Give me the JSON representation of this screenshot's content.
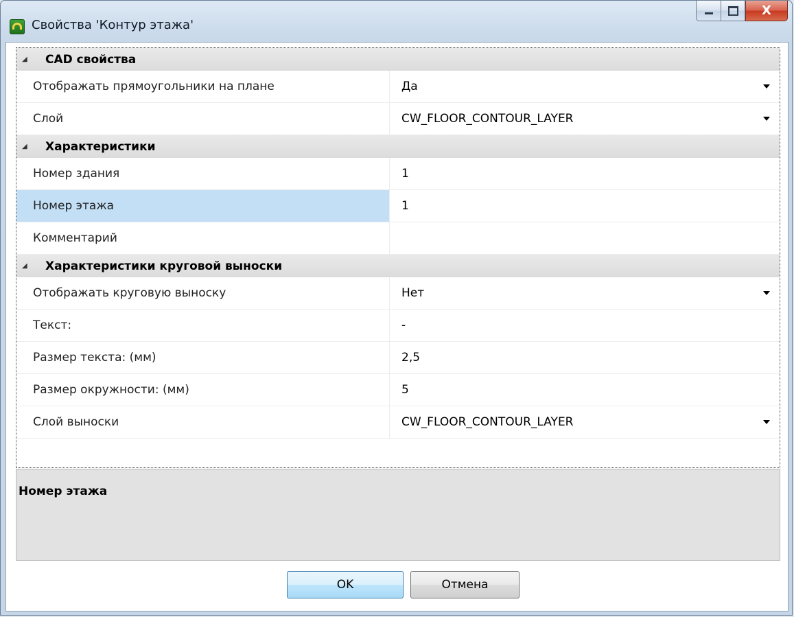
{
  "window": {
    "title": "Свойства 'Контур этажа'",
    "controls": {
      "minimize": "minimize",
      "maximize": "maximize",
      "close": "X"
    }
  },
  "grid": {
    "categories": [
      {
        "label": "CAD свойства",
        "rows": [
          {
            "name": "Отображать прямоугольники на плане",
            "value": "Да",
            "dropdown": true
          },
          {
            "name": "Слой",
            "value": "CW_FLOOR_CONTOUR_LAYER",
            "dropdown": true
          }
        ]
      },
      {
        "label": "Характеристики",
        "rows": [
          {
            "name": "Номер здания",
            "value": "1",
            "dropdown": false
          },
          {
            "name": "Номер этажа",
            "value": "1",
            "dropdown": false,
            "selected": true
          },
          {
            "name": "Комментарий",
            "value": "",
            "dropdown": false
          }
        ]
      },
      {
        "label": "Характеристики круговой выноски",
        "rows": [
          {
            "name": "Отображать круговую выноску",
            "value": "Нет",
            "dropdown": true
          },
          {
            "name": "Текст:",
            "value": "-",
            "dropdown": false
          },
          {
            "name": "Размер текста: (мм)",
            "value": "2,5",
            "dropdown": false
          },
          {
            "name": "Размер окружности: (мм)",
            "value": "5",
            "dropdown": false
          },
          {
            "name": "Слой выноски",
            "value": "CW_FLOOR_CONTOUR_LAYER",
            "dropdown": true
          }
        ]
      }
    ]
  },
  "description": {
    "title": "Номер этажа"
  },
  "buttons": {
    "ok": "OK",
    "cancel": "Отмена"
  },
  "colors": {
    "selection": "#c2dff6",
    "category_bg": "#dcdcdc",
    "window_frame": "#c9d8e9"
  }
}
